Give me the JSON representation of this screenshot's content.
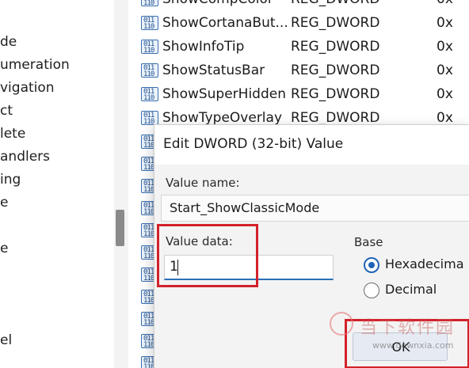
{
  "tree": {
    "items": [
      "de",
      "umeration",
      "vigation",
      "ct",
      "lete",
      "andlers",
      "ing",
      "e",
      "",
      "e",
      "",
      "",
      "",
      "el"
    ]
  },
  "values": {
    "rows": [
      {
        "name": "ShowCompColor",
        "type": "REG_DWORD",
        "data": "0x"
      },
      {
        "name": "ShowCortanaBut...",
        "type": "REG_DWORD",
        "data": "0x"
      },
      {
        "name": "ShowInfoTip",
        "type": "REG_DWORD",
        "data": "0x"
      },
      {
        "name": "ShowStatusBar",
        "type": "REG_DWORD",
        "data": "0x"
      },
      {
        "name": "ShowSuperHidden",
        "type": "REG_DWORD",
        "data": "0x"
      },
      {
        "name": "ShowTypeOverlay",
        "type": "REG_DWORD",
        "data": "0x"
      }
    ],
    "icon": "registry-dword-icon",
    "icon_glyph": "011\n110"
  },
  "dialog": {
    "title": "Edit DWORD (32-bit) Value",
    "value_name_label": "Value name:",
    "value_name": "Start_ShowClassicMode",
    "value_data_label": "Value data:",
    "value_data": "1",
    "base_label": "Base",
    "base_options": [
      {
        "label": "Hexadecima",
        "selected": true
      },
      {
        "label": "Decimal",
        "selected": false
      }
    ],
    "ok_label": "OK",
    "highlight_color": "#d3212a",
    "accent_color": "#1f63b8"
  },
  "watermark": {
    "text": "当下软件园",
    "url": "www.downxia.com"
  }
}
